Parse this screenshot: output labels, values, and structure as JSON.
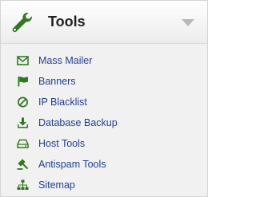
{
  "panel": {
    "title": "Tools",
    "header_icon": "wrench-icon",
    "collapse_icon": "chevron-down-icon"
  },
  "menu": [
    {
      "label": "Mass Mailer",
      "icon": "envelope-icon"
    },
    {
      "label": "Banners",
      "icon": "flag-icon"
    },
    {
      "label": "IP Blacklist",
      "icon": "ban-icon"
    },
    {
      "label": "Database Backup",
      "icon": "download-icon"
    },
    {
      "label": "Host Tools",
      "icon": "hard-drive-icon"
    },
    {
      "label": "Antispam Tools",
      "icon": "gavel-icon"
    },
    {
      "label": "Sitemap",
      "icon": "sitemap-icon"
    }
  ],
  "colors": {
    "icon_green": "#2f7a1f",
    "link_blue": "#1f3f8f",
    "header_bg": "#f7f7f7",
    "body_bg": "#f1f1f1",
    "chevron_gray": "#b8b8b8"
  }
}
